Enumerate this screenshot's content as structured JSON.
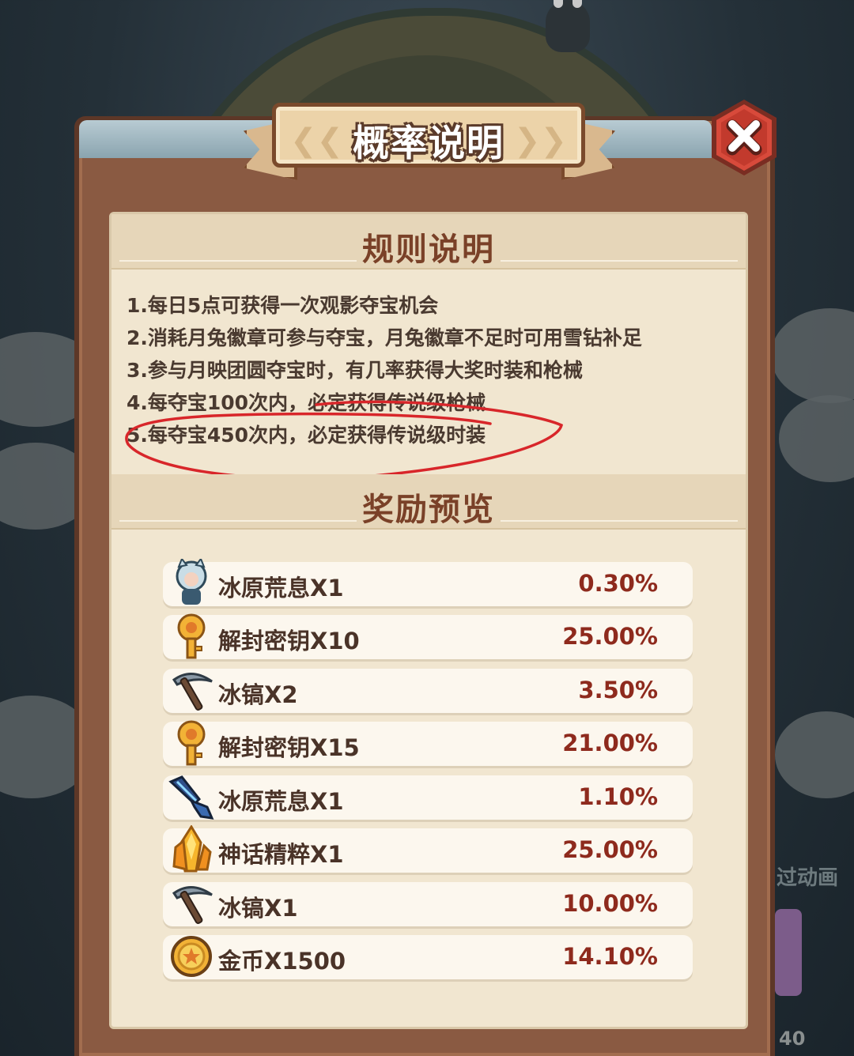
{
  "dialog": {
    "title": "概率说明",
    "close_icon": "close-icon"
  },
  "rules_section": {
    "title": "规则说明",
    "items": [
      "1.每日5点可获得一次观影夺宝机会",
      "2.消耗月兔徽章可参与夺宝，月兔徽章不足时可用雪钻补足",
      "3.参与月映团圆夺宝时，有几率获得大奖时装和枪械",
      "4.每夺宝100次内，必定获得传说级枪械",
      "5.每夺宝450次内，必定获得传说级时装"
    ]
  },
  "rewards_section": {
    "title": "奖励预览",
    "items": [
      {
        "icon": "character-skin-icon",
        "name": "冰原荒息X1",
        "prob": "0.30%"
      },
      {
        "icon": "key-icon",
        "name": "解封密钥X10",
        "prob": "25.00%"
      },
      {
        "icon": "pickaxe-icon",
        "name": "冰镐X2",
        "prob": "3.50%"
      },
      {
        "icon": "key-icon",
        "name": "解封密钥X15",
        "prob": "21.00%"
      },
      {
        "icon": "weapon-icon",
        "name": "冰原荒息X1",
        "prob": "1.10%"
      },
      {
        "icon": "crystal-icon",
        "name": "神话精粹X1",
        "prob": "25.00%"
      },
      {
        "icon": "pickaxe-icon",
        "name": "冰镐X1",
        "prob": "10.00%"
      },
      {
        "icon": "coin-icon",
        "name": "金币X1500",
        "prob": "14.10%"
      }
    ]
  },
  "background": {
    "skip_label": "过动画",
    "counter": "40"
  },
  "colors": {
    "frame": "#8a5a42",
    "panel": "#f1e6d0",
    "title_brown": "#7a4128",
    "prob_red": "#8e2a1d",
    "annotation_red": "#d8262a"
  }
}
